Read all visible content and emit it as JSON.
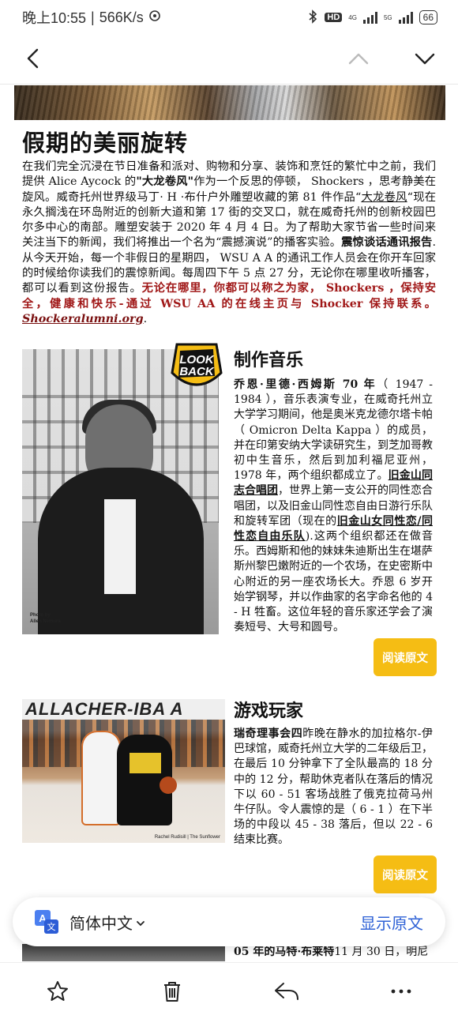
{
  "status_bar": {
    "time": "晚上10:55",
    "speed": "566K/s",
    "hd": "HD",
    "net1": "4G",
    "net2": "5G",
    "battery": "66"
  },
  "nav": {
    "back_icon": "chevron-left-icon",
    "up_icon": "chevron-up-icon",
    "down_icon": "chevron-down-icon"
  },
  "article": {
    "title": "假期的美丽旋转",
    "p1_a": "在我们完全沉浸在节日准备和派对、购物和分享、装饰和烹饪的繁忙中之前，我们提供 Alice Aycock 的",
    "p1_b": "\"大龙卷风\"",
    "p1_c": "作为一个反思的停顿， Shockers ，思考静美在旋风。威奇托州世界级马丁· H ·布什户外雕塑收藏的第 81 件作品“",
    "p1_d": "大龙卷风",
    "p1_e": "“现在永久搁浅在环岛附近的创新大道和第 17 街的交叉口，就在威奇托州的创新校园巴尔多中心的南部。雕塑安装于 2020 年 4 月 4 日。为了帮助大家节省一些时间来关注当下的新闻，我们将推出一个名为“震撼演说”的播客实验。",
    "p1_f": "震惊谈话通讯报告",
    "p1_g": ".从今天开始，每一个非假日的星期四， WSU A A 的通讯工作人员会在你开车回家的时候给你读我们的震惊新闻。每周四下午 5 点 27 分，无论你在哪里收听播客，都可以看到这份报告。",
    "p1_red": "无论在哪里，你都可以称之为家， Shockers ，保持安全，健康和快乐-通过 WSU AA 的在线主页与 Shocker 保持联系。",
    "p1_link": "Shockeralumni.org",
    "p1_end": "."
  },
  "card1": {
    "title": "制作音乐",
    "lead": "乔恩·里德·西姆斯 70 年",
    "t1": "（ 1947 - 1984 ），音乐表演专业，在威奇托州立大学学习期间，他是奥米克龙德尔塔卡帕（ Omicron Delta Kappa ）的成员，并在印第安纳大学读研究生，到芝加哥教初中生音乐，然后到加利福尼亚州， 1978 年，两个组织都成立了。",
    "u1": "旧金山同志合唱团",
    "t2": "，世界上第一支公开的同性恋合唱团，以及旧金山同性恋自由日游行乐队和旋转军团（现在的",
    "u2": "旧金山女同性恋/同性恋自由乐队",
    "t3": ").这两个组织都还在做音乐。西姆斯和他的妹妹朱迪斯出生在堪萨斯州黎巴嫩附近的一个农场，在史密斯中心附近的另一座农场长大。乔恩 6 岁开始学钢琴，并以作曲家的名字命名他的 4 - H 牲畜。这位年轻的音乐家还学会了演奏短号、大号和圆号。",
    "read": "阅读原文",
    "badge_line1": "LOOK",
    "badge_line2": "BACK",
    "photo_credit_1": "Photo by",
    "photo_credit_2": "Allen Nemura"
  },
  "card2": {
    "title": "游戏玩家",
    "lead": "瑞奇理事会四",
    "text": "昨晚在静水的加拉格尔-伊巴球馆，威奇托州立大学的二年级后卫，在最后 10 分钟拿下了全队最高的 18 分中的 12 分，帮助休克者队在落后的情况下以 60 - 51 客场战胜了俄克拉荷马州牛仔队。令人震惊的是（ 6 - 1 ）在下半场的中段以 45 - 38 落后，但以 22 - 6 结束比赛。",
    "read": "阅读原文",
    "banner": "ALLACHER-IBA A",
    "photo_credit": "Rachel Rudisill | The Sunflower"
  },
  "card3": {
    "lead": "05 年的马特·布莱特",
    "text": "11 月 30 日，明尼"
  },
  "translate": {
    "language": "简体中文",
    "show_original": "显示原文"
  },
  "bottom": {
    "star": "star-icon",
    "trash": "trash-icon",
    "reply": "reply-icon",
    "more": "more-icon"
  }
}
